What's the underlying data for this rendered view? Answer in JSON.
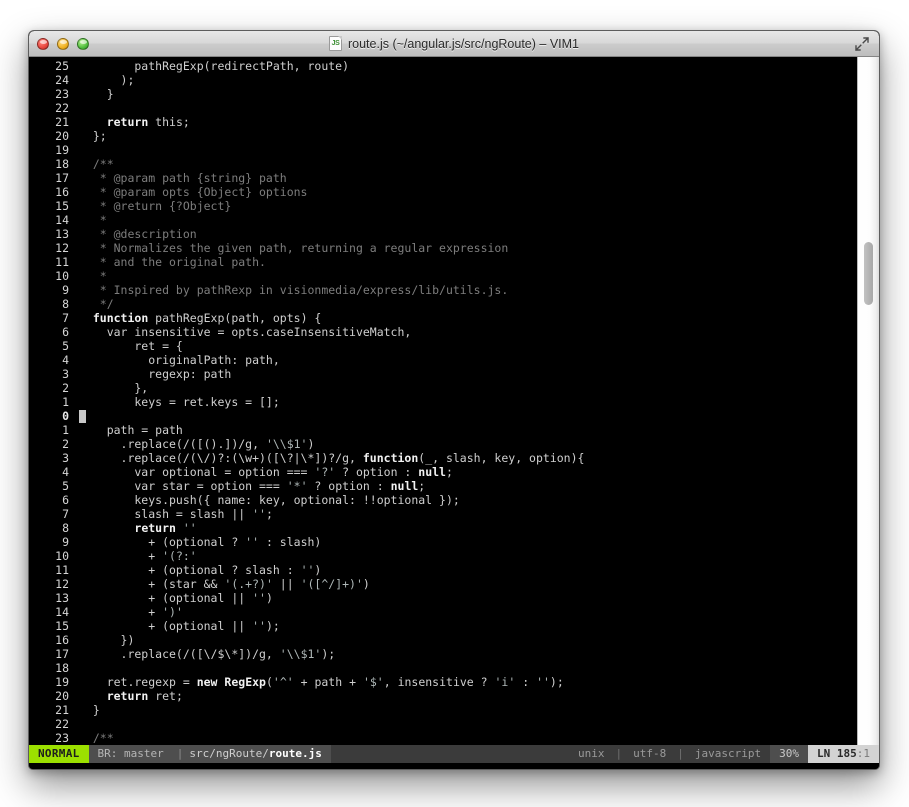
{
  "window": {
    "title": "route.js (~/angular.js/src/ngRoute) – VIM1",
    "file_icon_label": "JS",
    "traffic_lights": [
      "close",
      "minimize",
      "zoom"
    ],
    "fullscreen_icon": "expand-diagonal-icon"
  },
  "colors": {
    "mode_bg": "#9ce000",
    "status_bg": "#3b3b3b",
    "status_alt_bg": "#4e4e4e",
    "editor_bg": "#000000",
    "comment": "#7d7d7d",
    "text": "#cfcfcf"
  },
  "statusbar": {
    "mode": "NORMAL",
    "branch": "BR: master",
    "path_dir": "src/ngRoute/",
    "path_file": "route.js",
    "fileformat": "unix",
    "encoding": "utf-8",
    "filetype": "javascript",
    "percent": "30%",
    "line_label": "LN",
    "line": "185",
    "col": "1",
    "separator": "|"
  },
  "editor": {
    "cursor_line_number": "0",
    "lines": [
      {
        "n": "25",
        "segs": [
          {
            "t": "        pathRegExp(redirectPath, route)",
            "c": "pln"
          }
        ]
      },
      {
        "n": "24",
        "segs": [
          {
            "t": "      );",
            "c": "pln"
          }
        ]
      },
      {
        "n": "23",
        "segs": [
          {
            "t": "    }",
            "c": "pln"
          }
        ]
      },
      {
        "n": "22",
        "segs": [
          {
            "t": "",
            "c": "pln"
          }
        ]
      },
      {
        "n": "21",
        "segs": [
          {
            "t": "    ",
            "c": "pln"
          },
          {
            "t": "return",
            "c": "kw"
          },
          {
            "t": " this;",
            "c": "pln"
          }
        ]
      },
      {
        "n": "20",
        "segs": [
          {
            "t": "  };",
            "c": "pln"
          }
        ]
      },
      {
        "n": "19",
        "segs": [
          {
            "t": "",
            "c": "pln"
          }
        ]
      },
      {
        "n": "18",
        "segs": [
          {
            "t": "  /**",
            "c": "cmt"
          }
        ]
      },
      {
        "n": "17",
        "segs": [
          {
            "t": "   * @param path {string} path",
            "c": "cmt"
          }
        ]
      },
      {
        "n": "16",
        "segs": [
          {
            "t": "   * @param opts {Object} options",
            "c": "cmt"
          }
        ]
      },
      {
        "n": "15",
        "segs": [
          {
            "t": "   * @return {?Object}",
            "c": "cmt"
          }
        ]
      },
      {
        "n": "14",
        "segs": [
          {
            "t": "   *",
            "c": "cmt"
          }
        ]
      },
      {
        "n": "13",
        "segs": [
          {
            "t": "   * @description",
            "c": "cmt"
          }
        ]
      },
      {
        "n": "12",
        "segs": [
          {
            "t": "   * Normalizes the given path, returning a regular expression",
            "c": "cmt"
          }
        ]
      },
      {
        "n": "11",
        "segs": [
          {
            "t": "   * and the original path.",
            "c": "cmt"
          }
        ]
      },
      {
        "n": "10",
        "segs": [
          {
            "t": "   *",
            "c": "cmt"
          }
        ]
      },
      {
        "n": "9",
        "segs": [
          {
            "t": "   * Inspired by pathRexp in visionmedia/express/lib/utils.js.",
            "c": "cmt"
          }
        ]
      },
      {
        "n": "8",
        "segs": [
          {
            "t": "   */",
            "c": "cmt"
          }
        ]
      },
      {
        "n": "7",
        "segs": [
          {
            "t": "  ",
            "c": "pln"
          },
          {
            "t": "function",
            "c": "kw"
          },
          {
            "t": " pathRegExp(path, opts) {",
            "c": "pln"
          }
        ]
      },
      {
        "n": "6",
        "segs": [
          {
            "t": "    var insensitive = opts.caseInsensitiveMatch,",
            "c": "pln"
          }
        ]
      },
      {
        "n": "5",
        "segs": [
          {
            "t": "        ret = {",
            "c": "pln"
          }
        ]
      },
      {
        "n": "4",
        "segs": [
          {
            "t": "          originalPath: path,",
            "c": "pln"
          }
        ]
      },
      {
        "n": "3",
        "segs": [
          {
            "t": "          regexp: path",
            "c": "pln"
          }
        ]
      },
      {
        "n": "2",
        "segs": [
          {
            "t": "        },",
            "c": "pln"
          }
        ]
      },
      {
        "n": "1",
        "segs": [
          {
            "t": "        keys = ret.keys = [];",
            "c": "pln"
          }
        ]
      },
      {
        "n": "0",
        "current": true,
        "segs": [
          {
            "t": "",
            "c": "pln"
          }
        ]
      },
      {
        "n": "1",
        "segs": [
          {
            "t": "    path = path",
            "c": "pln"
          }
        ]
      },
      {
        "n": "2",
        "segs": [
          {
            "t": "      .replace(/([().])/g, ",
            "c": "pln"
          },
          {
            "t": "'\\\\$1'",
            "c": "str"
          },
          {
            "t": ")",
            "c": "pln"
          }
        ]
      },
      {
        "n": "3",
        "segs": [
          {
            "t": "      .replace(/(\\/)?:(\\w+)([\\?|\\*])?/g, ",
            "c": "pln"
          },
          {
            "t": "function",
            "c": "kw"
          },
          {
            "t": "(_, slash, key, option){",
            "c": "pln"
          }
        ]
      },
      {
        "n": "4",
        "segs": [
          {
            "t": "        var optional = option === ",
            "c": "pln"
          },
          {
            "t": "'?'",
            "c": "str"
          },
          {
            "t": " ? option : ",
            "c": "pln"
          },
          {
            "t": "null",
            "c": "kw"
          },
          {
            "t": ";",
            "c": "pln"
          }
        ]
      },
      {
        "n": "5",
        "segs": [
          {
            "t": "        var star = option === ",
            "c": "pln"
          },
          {
            "t": "'*'",
            "c": "str"
          },
          {
            "t": " ? option : ",
            "c": "pln"
          },
          {
            "t": "null",
            "c": "kw"
          },
          {
            "t": ";",
            "c": "pln"
          }
        ]
      },
      {
        "n": "6",
        "segs": [
          {
            "t": "        keys.push({ name: key, optional: !!optional });",
            "c": "pln"
          }
        ]
      },
      {
        "n": "7",
        "segs": [
          {
            "t": "        slash = slash || ",
            "c": "pln"
          },
          {
            "t": "''",
            "c": "str"
          },
          {
            "t": ";",
            "c": "pln"
          }
        ]
      },
      {
        "n": "8",
        "segs": [
          {
            "t": "        ",
            "c": "pln"
          },
          {
            "t": "return",
            "c": "kw"
          },
          {
            "t": " ",
            "c": "pln"
          },
          {
            "t": "''",
            "c": "str"
          }
        ]
      },
      {
        "n": "9",
        "segs": [
          {
            "t": "          + (optional ? ",
            "c": "pln"
          },
          {
            "t": "''",
            "c": "str"
          },
          {
            "t": " : slash)",
            "c": "pln"
          }
        ]
      },
      {
        "n": "10",
        "segs": [
          {
            "t": "          + ",
            "c": "pln"
          },
          {
            "t": "'(?:'",
            "c": "str"
          }
        ]
      },
      {
        "n": "11",
        "segs": [
          {
            "t": "          + (optional ? slash : ",
            "c": "pln"
          },
          {
            "t": "''",
            "c": "str"
          },
          {
            "t": ")",
            "c": "pln"
          }
        ]
      },
      {
        "n": "12",
        "segs": [
          {
            "t": "          + (star && ",
            "c": "pln"
          },
          {
            "t": "'(.+?)'",
            "c": "str"
          },
          {
            "t": " || ",
            "c": "pln"
          },
          {
            "t": "'([^/]+)'",
            "c": "str"
          },
          {
            "t": ")",
            "c": "pln"
          }
        ]
      },
      {
        "n": "13",
        "segs": [
          {
            "t": "          + (optional || ",
            "c": "pln"
          },
          {
            "t": "''",
            "c": "str"
          },
          {
            "t": ")",
            "c": "pln"
          }
        ]
      },
      {
        "n": "14",
        "segs": [
          {
            "t": "          + ",
            "c": "pln"
          },
          {
            "t": "')'",
            "c": "str"
          }
        ]
      },
      {
        "n": "15",
        "segs": [
          {
            "t": "          + (optional || ",
            "c": "pln"
          },
          {
            "t": "''",
            "c": "str"
          },
          {
            "t": ");",
            "c": "pln"
          }
        ]
      },
      {
        "n": "16",
        "segs": [
          {
            "t": "      })",
            "c": "pln"
          }
        ]
      },
      {
        "n": "17",
        "segs": [
          {
            "t": "      .replace(/([\\/$\\*])/g, ",
            "c": "pln"
          },
          {
            "t": "'\\\\$1'",
            "c": "str"
          },
          {
            "t": ");",
            "c": "pln"
          }
        ]
      },
      {
        "n": "18",
        "segs": [
          {
            "t": "",
            "c": "pln"
          }
        ]
      },
      {
        "n": "19",
        "segs": [
          {
            "t": "    ret.regexp = ",
            "c": "pln"
          },
          {
            "t": "new",
            "c": "kw"
          },
          {
            "t": " ",
            "c": "pln"
          },
          {
            "t": "RegExp",
            "c": "kw"
          },
          {
            "t": "(",
            "c": "pln"
          },
          {
            "t": "'^'",
            "c": "str"
          },
          {
            "t": " + path + ",
            "c": "pln"
          },
          {
            "t": "'$'",
            "c": "str"
          },
          {
            "t": ", insensitive ? ",
            "c": "pln"
          },
          {
            "t": "'i'",
            "c": "str"
          },
          {
            "t": " : ",
            "c": "pln"
          },
          {
            "t": "''",
            "c": "str"
          },
          {
            "t": ");",
            "c": "pln"
          }
        ]
      },
      {
        "n": "20",
        "segs": [
          {
            "t": "    ",
            "c": "pln"
          },
          {
            "t": "return",
            "c": "kw"
          },
          {
            "t": " ret;",
            "c": "pln"
          }
        ]
      },
      {
        "n": "21",
        "segs": [
          {
            "t": "  }",
            "c": "pln"
          }
        ]
      },
      {
        "n": "22",
        "segs": [
          {
            "t": "",
            "c": "pln"
          }
        ]
      },
      {
        "n": "23",
        "segs": [
          {
            "t": "  /**",
            "c": "cmt"
          }
        ]
      }
    ]
  }
}
